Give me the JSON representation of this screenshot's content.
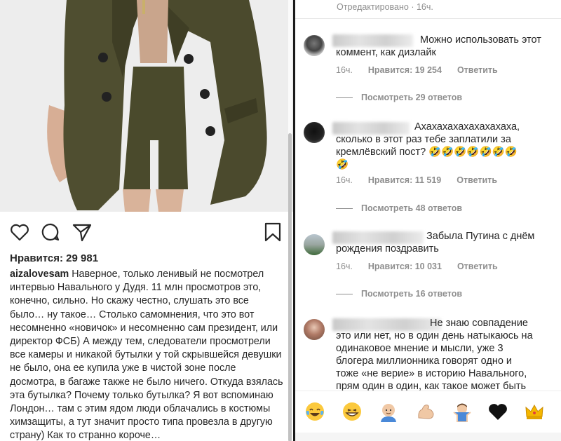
{
  "post": {
    "likes": "Нравится: 29 981",
    "caption_user": "aizalovesam",
    "caption_text": " Наверное, только ленивый не посмотрел интервью Навального у Дудя. 11 млн просмотров это, конечно, сильно. Но скажу честно, слушать это все было… ну такое… Столько самомнения, что это вот несомненно «новичок» и несомненно сам президент, или директор ФСБ) А между тем, следователи просмотрели все камеры и никакой бутылки у той скрывшейся девушки не было, она ее купила уже в чистой зоне после досмотра, в багаже также не было ничего. Откуда взялась эта бутылка? Почему только бутылка? Я вот вспоминаю Лондон… там с этим ядом люди облачались в костюмы химзащиты, а тут значит просто типа провезла в другую страну) Как то странно короче…",
    "icons": [
      "heart-icon",
      "comment-icon",
      "share-icon",
      "bookmark-icon"
    ]
  },
  "comments_panel": {
    "edited_label": "Отредактировано · 16ч.",
    "comments": [
      {
        "text": "Можно использовать этот комментарий, как дизлайк",
        "text_line1": "Можно использовать этот",
        "text_line2": "коммент, как дизлайк",
        "time": "16ч.",
        "likes": "Нравится: 19 254",
        "reply": "Ответить",
        "view_replies": "Посмотреть 29 ответов"
      },
      {
        "text_line1": "Ахахахахахахахахаха,",
        "text_line2": "сколько в этот раз тебе заплатили за",
        "text_line3": "кремлёвский пост? 🤣🤣🤣🤣🤣🤣🤣",
        "text_line4": "🤣",
        "time": "16ч.",
        "likes": "Нравится: 11 519",
        "reply": "Ответить",
        "view_replies": "Посмотреть 48 ответов"
      },
      {
        "text_line1": "Забыла Путина с днём",
        "text_line2": "рождения поздравить",
        "time": "16ч.",
        "likes": "Нравится: 10 031",
        "reply": "Ответить",
        "view_replies": "Посмотреть 16 ответов"
      },
      {
        "text_line1": "Не знаю совпадение",
        "text_line2": "это или нет, но в один день натыкаюсь на",
        "text_line3": "одинаковое мнение и мысли, уже 3",
        "text_line4": "блогера миллионника говорят одно и",
        "text_line5": "тоже «не верие» в историю Навального,",
        "text_line6": "прям один в один, как такое может быть"
      }
    ],
    "emoji_bar": [
      "😂",
      "😁",
      "👨‍🦲",
      "💪",
      "🤷‍♂️",
      "🖤",
      "👑"
    ]
  },
  "colors": {
    "text": "#262626",
    "muted": "#8e8e8e",
    "jacket": "#4a4a2c"
  }
}
